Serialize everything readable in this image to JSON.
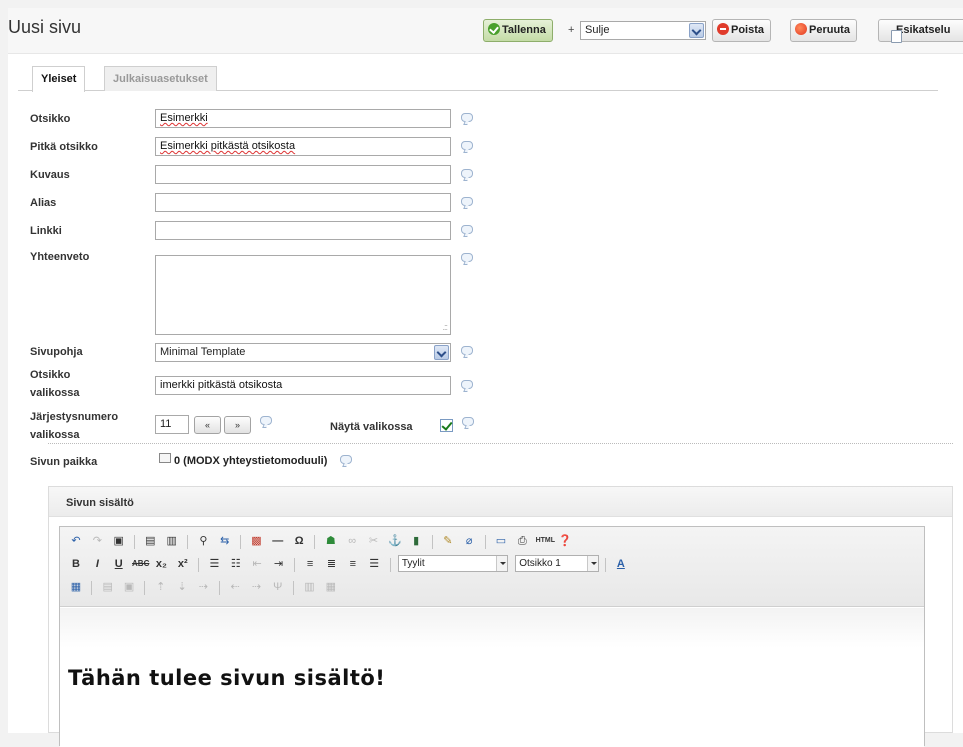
{
  "header": {
    "title": "Uusi sivu",
    "save_label": "Tallenna",
    "plus": "+",
    "close_select_value": "Sulje",
    "delete_label": "Poista",
    "cancel_label": "Peruuta",
    "preview_label": "Esikatselu"
  },
  "tabs": {
    "general": "Yleiset",
    "publish": "Julkaisuasetukset"
  },
  "form": {
    "title_label": "Otsikko",
    "title_value": "Esimerkki",
    "longtitle_label": "Pitkä otsikko",
    "longtitle_value": "Esimerkki pitkästä otsikosta",
    "description_label": "Kuvaus",
    "description_value": "",
    "alias_label": "Alias",
    "alias_value": "",
    "link_label": "Linkki",
    "link_value": "",
    "summary_label": "Yhteenveto",
    "template_label": "Sivupohja",
    "template_value": "Minimal Template",
    "menutitle_label_1": "Otsikko",
    "menutitle_label_2": "valikossa",
    "menutitle_value": "imerkki pitkästä otsikosta",
    "menuindex_label_1": "Järjestysnumero",
    "menuindex_label_2": "valikossa",
    "menuindex_value": "11",
    "spin_down": "«",
    "spin_up": "»",
    "show_in_menu_label": "Näytä valikossa",
    "show_in_menu_checked": true,
    "parent_label": "Sivun paikka",
    "parent_value": "0 (MODX yhteystietomoduuli)"
  },
  "content": {
    "panel_title": "Sivun sisältö",
    "styles_select": "Tyylit",
    "format_select": "Otsikko 1",
    "heading": "Tähän tulee sivun sisältö!"
  },
  "colors": {
    "save_button": "#c4dca6",
    "delete_icon": "#e03b2b",
    "cancel_icon": "#e2361f"
  }
}
